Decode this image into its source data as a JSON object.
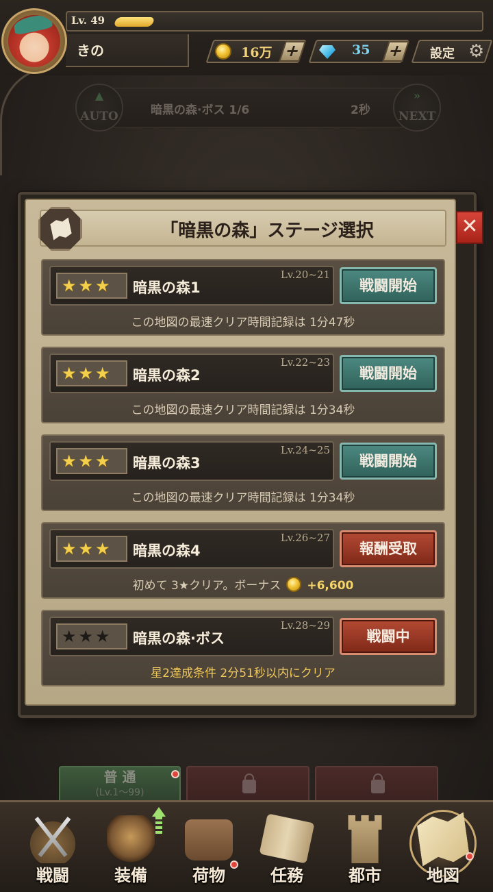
{
  "hud": {
    "level": "Lv. 49",
    "exp_fraction": 0.1,
    "player_name": "きの",
    "gold": "16万",
    "gems": "35",
    "add_symbol": "+",
    "settings_label": "設定",
    "gear_glyph": "⚙"
  },
  "stage_bar": {
    "auto_label": "AUTO",
    "stage_progress": "暗黒の森·ボス   1/6",
    "timer": "2秒",
    "next_label": "NEXT"
  },
  "dialog": {
    "title": "「暗黒の森」ステージ選択",
    "close_glyph": "✕",
    "stages": [
      {
        "stars": "★★★",
        "name": "暗黒の森1",
        "level_range": "Lv.20~21",
        "button": "戦闘開始",
        "note": "この地図の最速クリア時間記録は 1分47秒"
      },
      {
        "stars": "★★★",
        "name": "暗黒の森2",
        "level_range": "Lv.22~23",
        "button": "戦闘開始",
        "note": "この地図の最速クリア時間記録は 1分34秒"
      },
      {
        "stars": "★★★",
        "name": "暗黒の森3",
        "level_range": "Lv.24~25",
        "button": "戦闘開始",
        "note": "この地図の最速クリア時間記録は 1分34秒"
      },
      {
        "stars": "★★★",
        "name": "暗黒の森4",
        "level_range": "Lv.26~27",
        "button": "報酬受取",
        "note": "初めて 3★クリア。ボーナス",
        "bonus": "+6,600"
      },
      {
        "stars": "★★★",
        "name": "暗黒の森·ボス",
        "level_range": "Lv.28~29",
        "button": "戦闘中",
        "note": "星2達成条件 2分51秒以内にクリア"
      }
    ]
  },
  "difficulty": {
    "normal_label": "普 通",
    "normal_range": "(Lv.1～99)"
  },
  "nav": {
    "items": [
      {
        "label": "戦闘",
        "icon": "crossed-swords-icon"
      },
      {
        "label": "装備",
        "icon": "helmet-icon"
      },
      {
        "label": "荷物",
        "icon": "bag-icon"
      },
      {
        "label": "任務",
        "icon": "scroll-icon"
      },
      {
        "label": "都市",
        "icon": "tower-icon"
      },
      {
        "label": "地図",
        "icon": "map-icon"
      }
    ]
  },
  "colors": {
    "teal_button": "#2f6159",
    "red_button": "#7f2818",
    "gold_star": "#f3cf4c",
    "panel_parchment": "#c7b999"
  }
}
